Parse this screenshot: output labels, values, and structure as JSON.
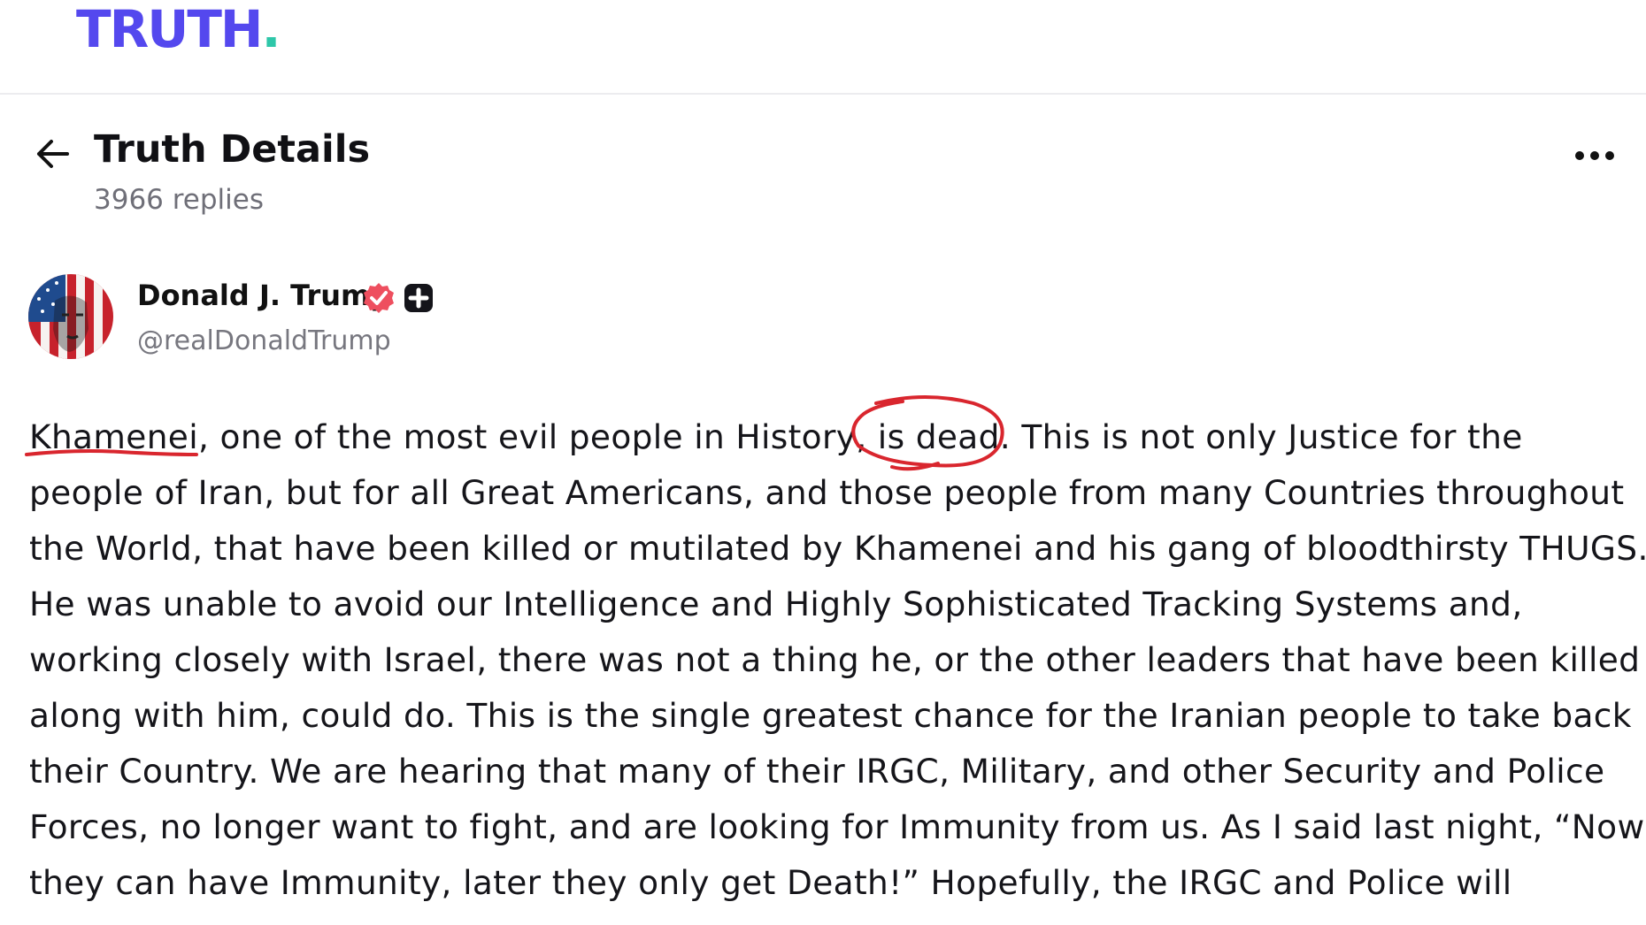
{
  "header": {
    "logo_text": "TRUTH",
    "logo_dot": ".",
    "logo_color": "#5448ee",
    "logo_dot_color": "#2ec7a9"
  },
  "details": {
    "back_icon": "arrow-left-icon",
    "title": "Truth Details",
    "replies": "3966 replies",
    "more_icon": "more-horizontal-icon"
  },
  "author": {
    "name": "Donald J. Trump",
    "handle": "@realDonaldTrump",
    "verified_icon": "verified-badge-icon",
    "verified_color": "#ee4f5f",
    "plus_icon": "plus-badge-icon"
  },
  "post": {
    "lines": [
      "Khamenei, one of the most evil people in History, is dead. This is not only Justice for the",
      "people of Iran, but for all Great Americans, and those people from many Countries throughout",
      "the World, that have been killed or mutilated by Khamenei and his gang of bloodthirsty THUGS.",
      "He was unable to avoid our Intelligence and Highly Sophisticated Tracking Systems and,",
      "working closely with Israel, there was not a thing he, or the other leaders that have been killed",
      "along with him, could do. This is the single greatest chance for the Iranian people to take back",
      "their Country. We are hearing that many of their IRGC, Military, and other Security and Police",
      "Forces, no longer want to fight, and are looking for Immunity from us. As I said last night, “Now",
      "they can have Immunity, later they only get Death!” Hopefully, the IRGC and Police will"
    ]
  },
  "annotations": {
    "color": "#d9262e"
  }
}
